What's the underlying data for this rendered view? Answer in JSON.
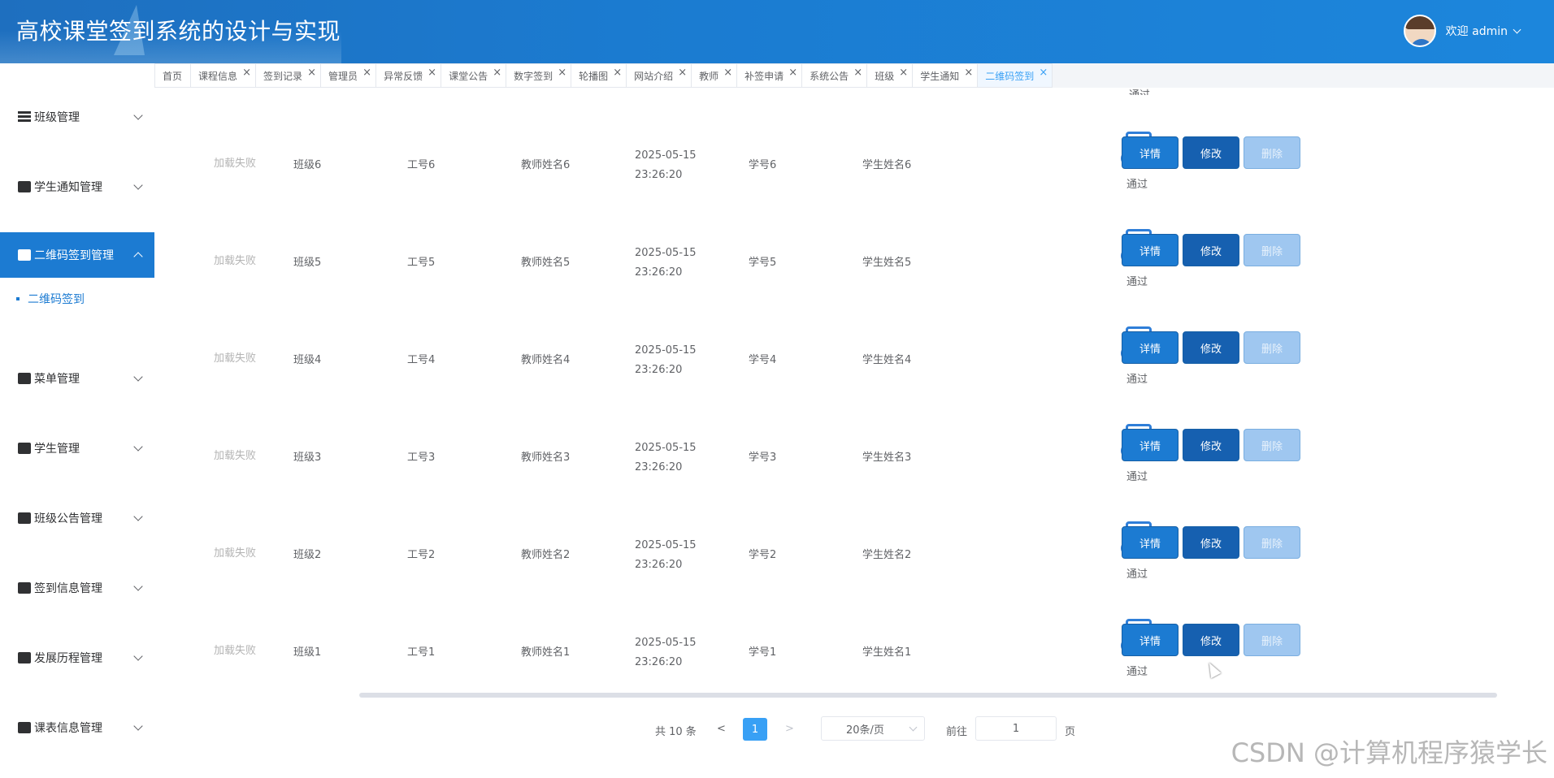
{
  "header": {
    "title": "高校课堂签到系统的设计与实现",
    "welcome": "欢迎 admin"
  },
  "sidebar": {
    "items": [
      {
        "label": "班级管理",
        "icon": "list-icon",
        "expanded": false
      },
      {
        "label": "学生通知管理",
        "icon": "notice-icon",
        "expanded": false
      },
      {
        "label": "二维码签到管理",
        "icon": "briefcase-icon",
        "expanded": true,
        "children": [
          {
            "label": "二维码签到"
          }
        ]
      },
      {
        "label": "菜单管理",
        "icon": "gift-icon",
        "expanded": false
      },
      {
        "label": "学生管理",
        "icon": "user-icon",
        "expanded": false
      },
      {
        "label": "班级公告管理",
        "icon": "bank-icon",
        "expanded": false
      },
      {
        "label": "签到信息管理",
        "icon": "id-card-icon",
        "expanded": false
      },
      {
        "label": "发展历程管理",
        "icon": "history-icon",
        "expanded": false
      },
      {
        "label": "课表信息管理",
        "icon": "calendar-icon",
        "expanded": false
      }
    ]
  },
  "tabs": [
    {
      "label": "首页",
      "closable": false
    },
    {
      "label": "课程信息",
      "closable": true
    },
    {
      "label": "签到记录",
      "closable": true
    },
    {
      "label": "管理员",
      "closable": true
    },
    {
      "label": "异常反馈",
      "closable": true
    },
    {
      "label": "课堂公告",
      "closable": true
    },
    {
      "label": "数字签到",
      "closable": true
    },
    {
      "label": "轮播图",
      "closable": true
    },
    {
      "label": "网站介绍",
      "closable": true
    },
    {
      "label": "教师",
      "closable": true
    },
    {
      "label": "补签申请",
      "closable": true
    },
    {
      "label": "系统公告",
      "closable": true
    },
    {
      "label": "班级",
      "closable": true
    },
    {
      "label": "学生通知",
      "closable": true
    },
    {
      "label": "二维码签到",
      "closable": true,
      "active": true
    }
  ],
  "tab_close_glyph": "×",
  "table": {
    "top_cut_text": "通过",
    "rows": [
      {
        "image": "加载失败",
        "class": "班级6",
        "teacher_id": "工号6",
        "teacher_name": "教师姓名6",
        "time": "2025-05-15 23:26:20",
        "student_id": "学号6",
        "student_name": "学生姓名6",
        "status": "通过"
      },
      {
        "image": "加载失败",
        "class": "班级5",
        "teacher_id": "工号5",
        "teacher_name": "教师姓名5",
        "time": "2025-05-15 23:26:20",
        "student_id": "学号5",
        "student_name": "学生姓名5",
        "status": "通过"
      },
      {
        "image": "加载失败",
        "class": "班级4",
        "teacher_id": "工号4",
        "teacher_name": "教师姓名4",
        "time": "2025-05-15 23:26:20",
        "student_id": "学号4",
        "student_name": "学生姓名4",
        "status": "通过"
      },
      {
        "image": "加载失败",
        "class": "班级3",
        "teacher_id": "工号3",
        "teacher_name": "教师姓名3",
        "time": "2025-05-15 23:26:20",
        "student_id": "学号3",
        "student_name": "学生姓名3",
        "status": "通过"
      },
      {
        "image": "加载失败",
        "class": "班级2",
        "teacher_id": "工号2",
        "teacher_name": "教师姓名2",
        "time": "2025-05-15 23:26:20",
        "student_id": "学号2",
        "student_name": "学生姓名2",
        "status": "通过"
      },
      {
        "image": "加载失败",
        "class": "班级1",
        "teacher_id": "工号1",
        "teacher_name": "教师姓名1",
        "time": "2025-05-15 23:26:20",
        "student_id": "学号1",
        "student_name": "学生姓名1",
        "status": "通过"
      }
    ],
    "actions": {
      "detail": "详情",
      "edit": "修改",
      "delete": "删除"
    }
  },
  "pagination": {
    "total": "共 10 条",
    "prev": "<",
    "next": ">",
    "current": "1",
    "page_size": "20条/页",
    "goto_label": "前往",
    "goto_value": "1",
    "page_unit": "页"
  },
  "watermark": "CSDN @计算机程序猿学长",
  "colors": {
    "primary": "#1c7bd2",
    "header": "#1b7bd0",
    "active_tab": "#38a0f5",
    "delete_btn": "#9fc7f0"
  }
}
